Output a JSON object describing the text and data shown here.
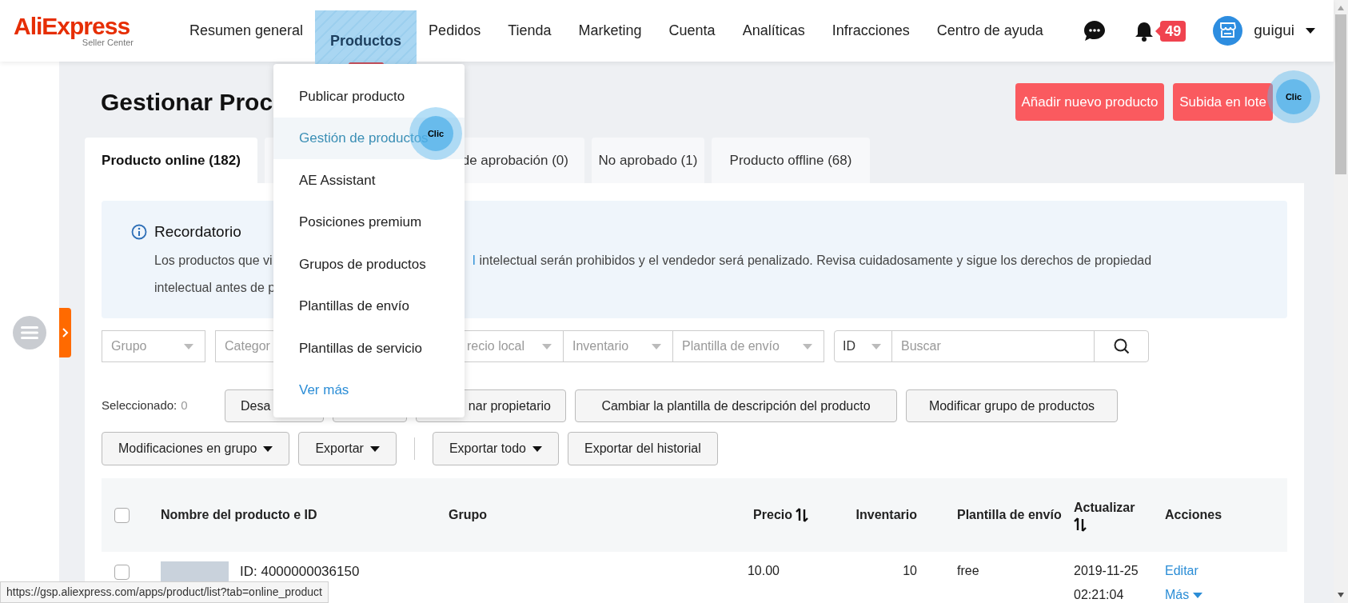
{
  "header": {
    "logo": {
      "brand": "AliExpress",
      "sub": "Seller Center"
    },
    "nav": [
      {
        "label": "Resumen general",
        "selected": false
      },
      {
        "label": "Productos",
        "selected": true
      },
      {
        "label": "Pedidos",
        "selected": false
      },
      {
        "label": "Tienda",
        "selected": false
      },
      {
        "label": "Marketing",
        "selected": false
      },
      {
        "label": "Cuenta",
        "selected": false
      },
      {
        "label": "Analíticas",
        "selected": false
      },
      {
        "label": "Infracciones",
        "selected": false
      },
      {
        "label": "Centro de ayuda",
        "selected": false
      }
    ],
    "notifications": {
      "count": "49"
    },
    "user": {
      "name": "guigui"
    }
  },
  "nav_menu": {
    "items": [
      {
        "kind": "item",
        "label": "Publicar producto",
        "selected": false
      },
      {
        "kind": "item",
        "label": "Gestión de productos",
        "selected": true
      },
      {
        "kind": "item",
        "label": "AE Assistant",
        "selected": false
      },
      {
        "kind": "item",
        "label": "Posiciones premium",
        "selected": false
      },
      {
        "kind": "item",
        "label": "Grupos de productos",
        "selected": false
      },
      {
        "kind": "item",
        "label": "Plantillas de envío",
        "selected": false
      },
      {
        "kind": "item",
        "label": "Plantillas de servicio",
        "selected": false
      },
      {
        "kind": "link",
        "label": "Ver más",
        "selected": false
      }
    ]
  },
  "page": {
    "title": "Gestionar Proc",
    "buttons": [
      "Añadir nuevo producto",
      "Subida en lote"
    ]
  },
  "tabs": [
    {
      "label": "Producto online (182)",
      "selected": true
    },
    {
      "label": "de aprobación (0)",
      "selected": false
    },
    {
      "label": "No aprobado (1)",
      "selected": false
    },
    {
      "label": "Producto offline (68)",
      "selected": false
    }
  ],
  "reminder": {
    "title": "Recordatorio",
    "line_1_start": "Los productos que vi",
    "line_1_link": "l",
    "line_1_end": "intelectual serán prohibidos y el vendedor será penalizado. Revisa cuidadosamente y sigue los derechos de propiedad",
    "line_2": "intelectual antes de p"
  },
  "filters": [
    {
      "label": "Grupo"
    },
    {
      "label": "Categor"
    },
    {
      "label": "recio local"
    },
    {
      "label": "Inventario"
    },
    {
      "label": "Plantilla de envío"
    }
  ],
  "search": {
    "type_label": "ID",
    "placeholder": "Buscar"
  },
  "selection": {
    "label": "Seleccionado:",
    "count": "0"
  },
  "actions_row_1": [
    {
      "kind": "button",
      "label": "Desa"
    },
    {
      "kind": "covered"
    },
    {
      "kind": "button",
      "label": "nar propietario"
    },
    {
      "kind": "button",
      "label": "Cambiar la plantilla de descripción del producto"
    },
    {
      "kind": "button",
      "label": "Modificar grupo de productos"
    }
  ],
  "actions_row_2": {
    "group_1": [
      {
        "label": "Modificaciones en grupo",
        "dropdown": true
      },
      {
        "label": "Exportar",
        "dropdown": true
      }
    ],
    "group_2": [
      {
        "label": "Exportar todo",
        "dropdown": true
      },
      {
        "label": "Exportar del historial",
        "dropdown": false
      }
    ]
  },
  "table": {
    "select_all_checked": false,
    "columns": [
      {
        "label": "Nombre del producto e ID",
        "sortable": false
      },
      {
        "label": "Grupo",
        "sortable": false
      },
      {
        "label": "Precio",
        "sortable": true
      },
      {
        "label": "Inventario",
        "sortable": false
      },
      {
        "label": "Plantilla de envío",
        "sortable": false
      },
      {
        "label": "Actualizar",
        "sortable": true
      },
      {
        "label": "Acciones",
        "sortable": false
      }
    ],
    "rows": [
      {
        "selected": false,
        "product_id": "ID: 4000000036150",
        "price": "10.00",
        "inventory": "10",
        "shipping": "free",
        "updated_date": "2019-11-25",
        "updated_time": "02:21:04",
        "actions": [
          {
            "label": "Editar",
            "dropdown": false
          },
          {
            "label": "Más",
            "dropdown": true
          }
        ]
      }
    ]
  },
  "click_markers": [
    {
      "label": "Clic"
    },
    {
      "label": "Clic"
    }
  ],
  "status_url": "https://gsp.aliexpress.com/apps/product/list?tab=online_product"
}
